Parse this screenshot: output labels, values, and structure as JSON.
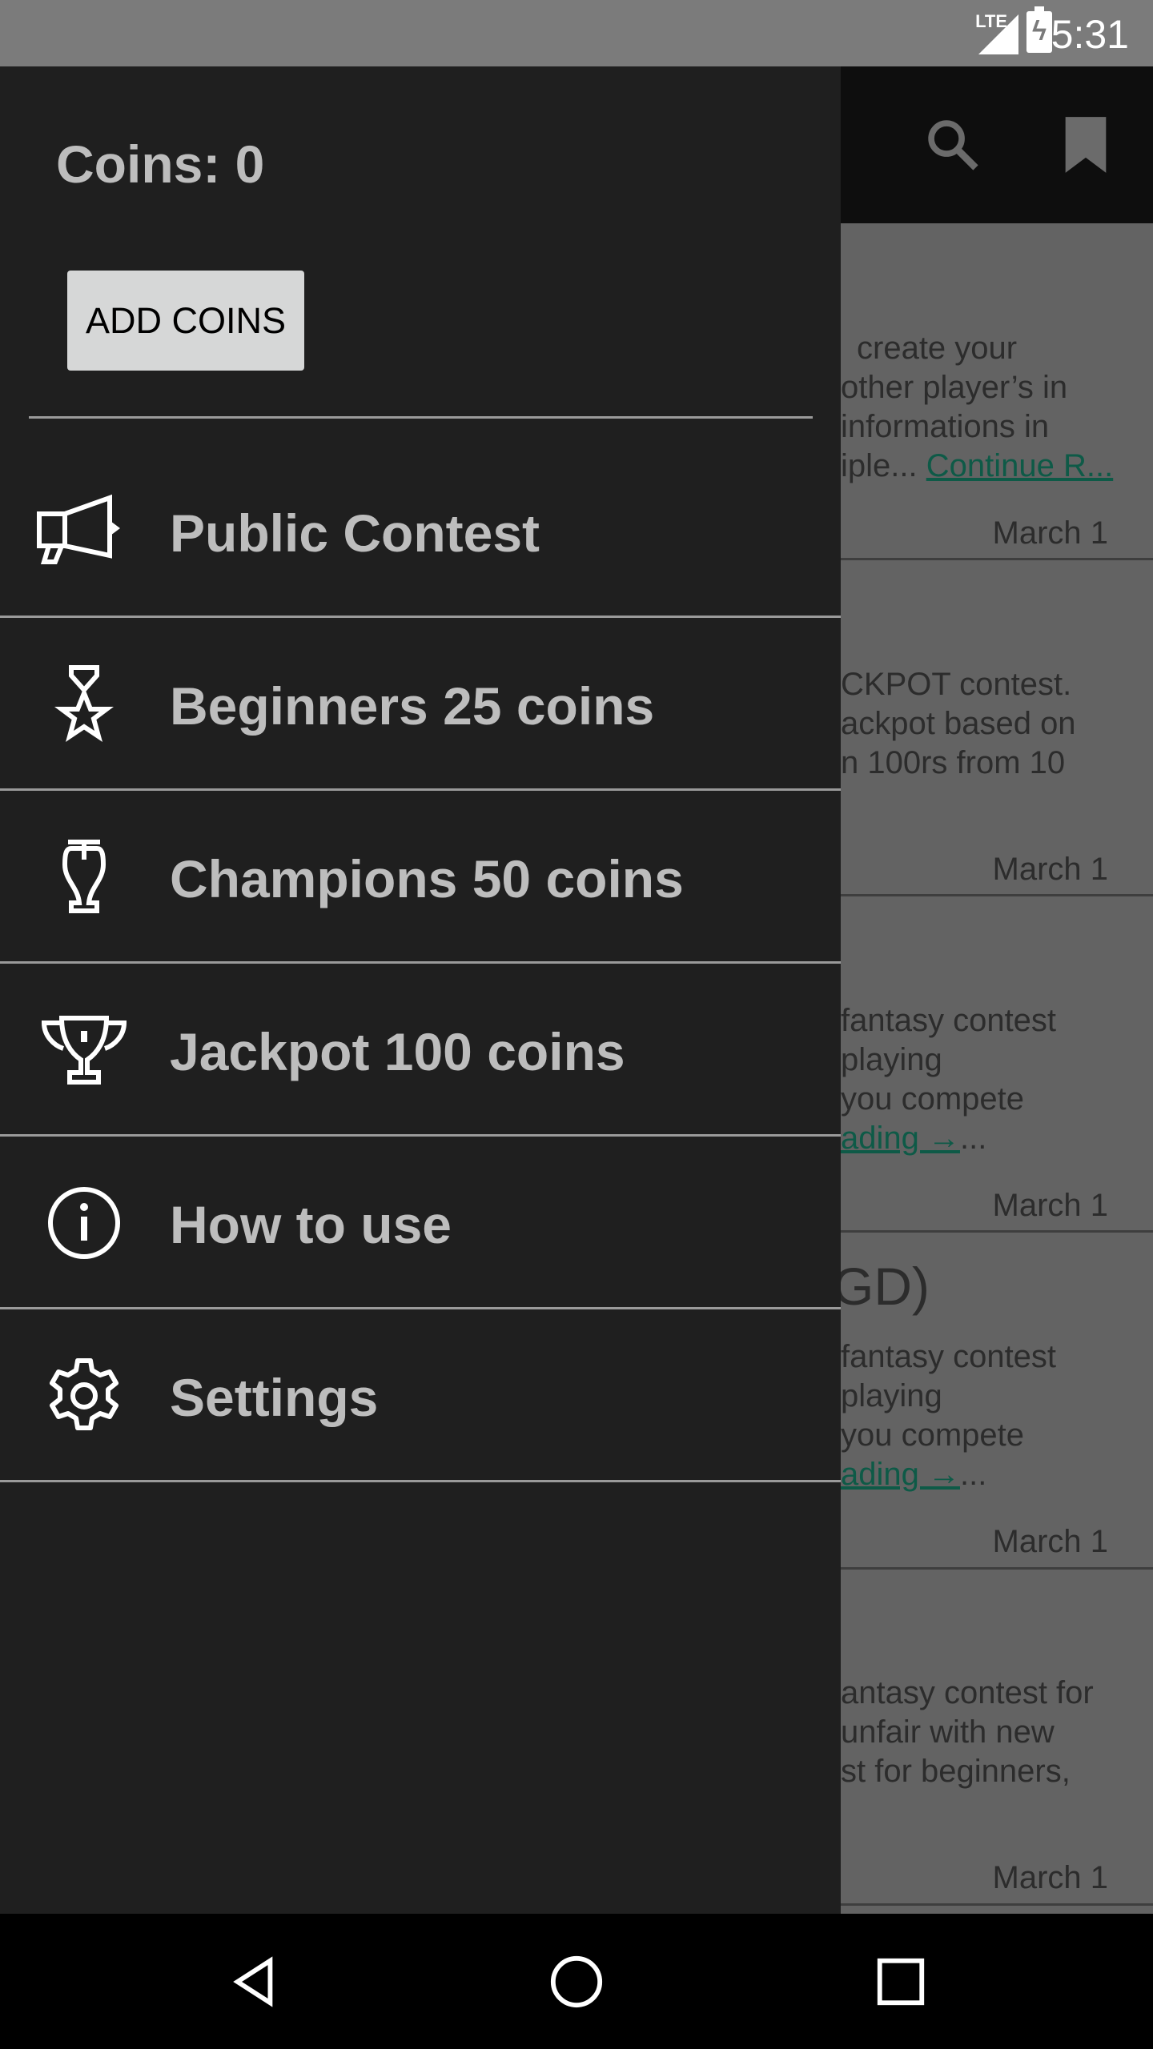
{
  "status_bar": {
    "network": "LTE",
    "time": "5:31"
  },
  "toolbar": {
    "icons": [
      "search-icon",
      "bookmark-icon"
    ]
  },
  "background_cards": [
    {
      "lines": [
        "create your",
        "other player’s in",
        "informations in",
        "iple..."
      ],
      "link": "Continue R...",
      "date": "March 1"
    },
    {
      "lines": [
        "CKPOT contest.",
        "ackpot based on",
        "n 100rs from 10"
      ],
      "date": "March 1"
    },
    {
      "lines": [
        "fantasy contest",
        "playing",
        "you compete"
      ],
      "link": "ading →",
      "suffix": "...",
      "date": "March 1"
    },
    {
      "title": "GD)",
      "lines": [
        "fantasy contest",
        "playing",
        "you compete"
      ],
      "link": "ading →",
      "suffix": "...",
      "date": "March 1"
    },
    {
      "lines": [
        "antasy contest for",
        "unfair with new",
        "st for beginners,"
      ],
      "date": "March 1"
    }
  ],
  "drawer": {
    "coins_label": "Coins: 0",
    "add_coins_label": "ADD COINS",
    "items": [
      {
        "label": "Public Contest",
        "icon": "megaphone-icon"
      },
      {
        "label": "Beginners 25 coins",
        "icon": "medal-star-icon"
      },
      {
        "label": "Champions 50 coins",
        "icon": "cup-icon"
      },
      {
        "label": "Jackpot 100 coins",
        "icon": "trophy-icon"
      },
      {
        "label": "How to use",
        "icon": "info-icon"
      },
      {
        "label": "Settings",
        "icon": "gear-icon"
      }
    ]
  },
  "nav_bar": {
    "icons": [
      "back-icon",
      "home-icon",
      "recents-icon"
    ]
  },
  "colors": {
    "drawer_bg": "#1f1f1f",
    "drawer_text": "#bdbdbd",
    "link": "#0e5a47",
    "button_bg": "#d6d7d7"
  }
}
